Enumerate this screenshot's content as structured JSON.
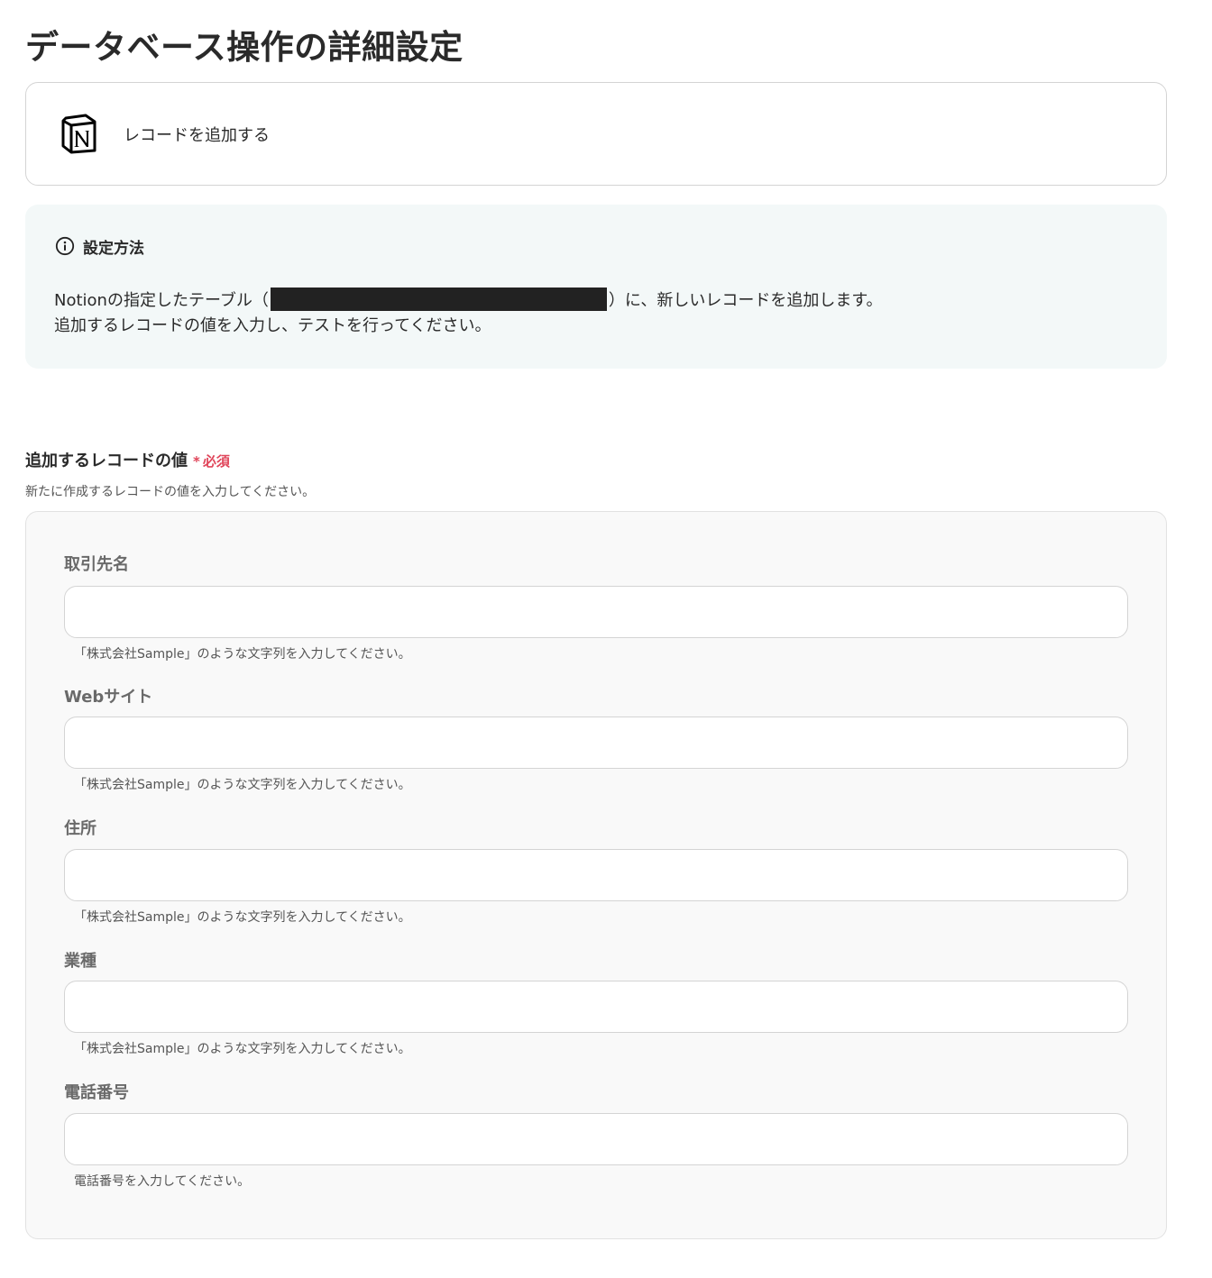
{
  "page": {
    "title": "データベース操作の詳細設定"
  },
  "action": {
    "icon": "notion-logo-icon",
    "label": "レコードを追加する"
  },
  "info": {
    "icon": "info-circle-icon",
    "title": "設定方法",
    "line1_before": "Notionの指定したテーブル（",
    "line1_after": "）に、新しいレコードを追加します。",
    "line2": "追加するレコードの値を入力し、テストを行ってください。"
  },
  "section": {
    "title": "追加するレコードの値",
    "required_mark": "*",
    "required_text": "必須",
    "description": "新たに作成するレコードの値を入力してください。"
  },
  "fields": [
    {
      "label": "取引先名",
      "value": "",
      "hint": "「株式会社Sample」のような文字列を入力してください。"
    },
    {
      "label": "Webサイト",
      "value": "",
      "hint": "「株式会社Sample」のような文字列を入力してください。"
    },
    {
      "label": "住所",
      "value": "",
      "hint": "「株式会社Sample」のような文字列を入力してください。"
    },
    {
      "label": "業種",
      "value": "",
      "hint": "「株式会社Sample」のような文字列を入力してください。"
    },
    {
      "label": "電話番号",
      "value": "",
      "hint": "電話番号を入力してください。"
    }
  ],
  "colors": {
    "required": "#e0455a",
    "info_background": "#f3f8f8",
    "panel_background": "#f9f9f9"
  }
}
